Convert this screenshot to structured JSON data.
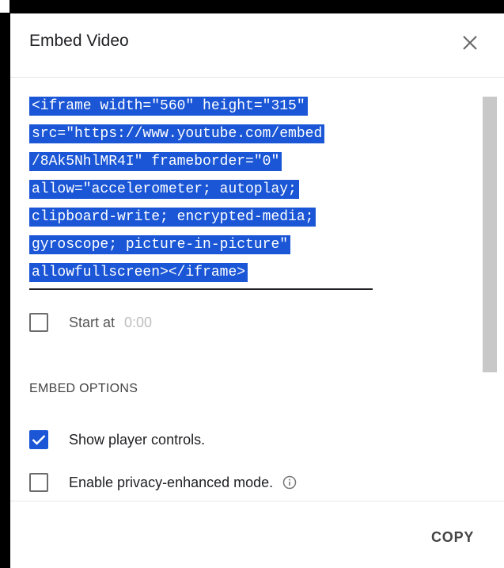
{
  "dialog": {
    "title": "Embed Video",
    "close_icon": "close-icon",
    "copy_label": "COPY"
  },
  "embed_code": {
    "lines": [
      "<iframe width=\"560\" height=\"315\"",
      "src=\"https://www.youtube.com/embed",
      "/8Ak5NhlMR4I\" frameborder=\"0\"",
      "allow=\"accelerometer; autoplay;",
      "clipboard-write; encrypted-media;",
      "gyroscope; picture-in-picture\"",
      "allowfullscreen></iframe>"
    ]
  },
  "start_at": {
    "label": "Start at",
    "value": "0:00",
    "checked": false
  },
  "embed_options": {
    "heading": "EMBED OPTIONS",
    "show_controls_label": "Show player controls.",
    "show_controls_checked": true,
    "privacy_label": "Enable privacy-enhanced mode.",
    "privacy_checked": false,
    "info_icon": "info-icon"
  },
  "colors": {
    "selection": "#1a56d6",
    "checkbox_checked": "#1a56d6",
    "text": "#202124"
  }
}
